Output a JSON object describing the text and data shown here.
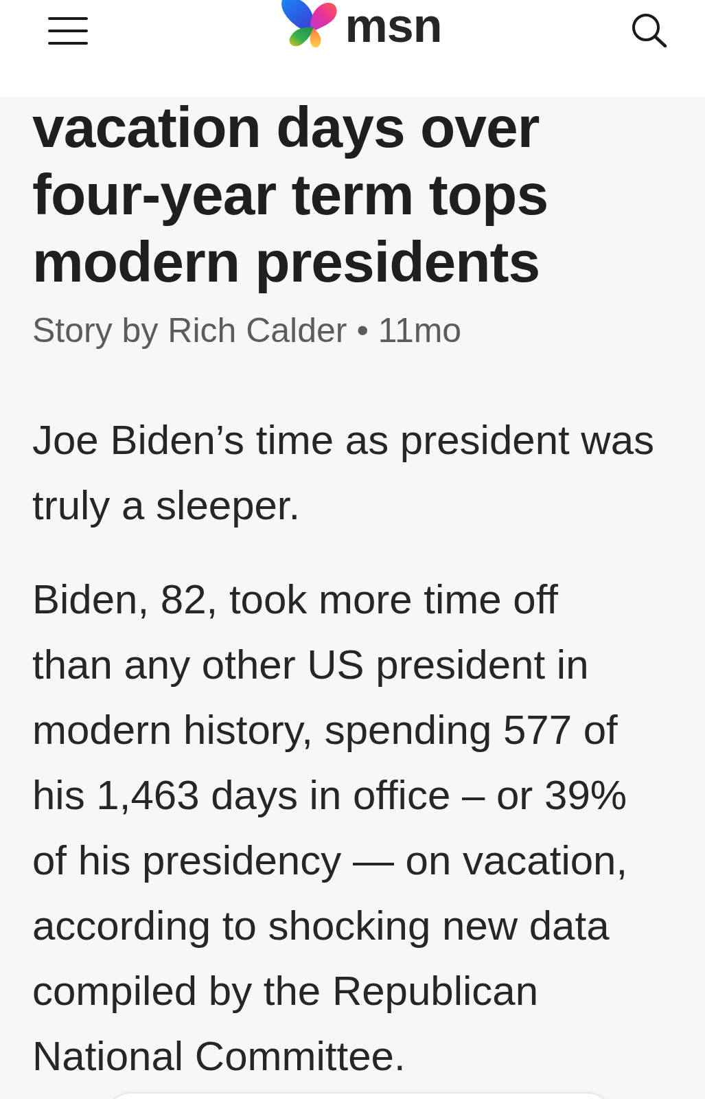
{
  "header": {
    "logo_text": "msn"
  },
  "article": {
    "headline_lines": [
      "vacation days over",
      "four-year term tops",
      "modern presidents"
    ],
    "byline": "Story by Rich Calder • 11mo",
    "paragraphs": [
      {
        "lines": [
          "Joe Biden’s time as president was",
          "truly a sleeper."
        ]
      },
      {
        "lines": [
          "Biden, 82, took more time off",
          "than any other US president in",
          "modern history, spending 577 of",
          "his 1,463 days in office – or 39%",
          "of his presidency — on vacation,",
          "according to shocking new data",
          "compiled by the Republican",
          "National Committee."
        ]
      }
    ]
  }
}
